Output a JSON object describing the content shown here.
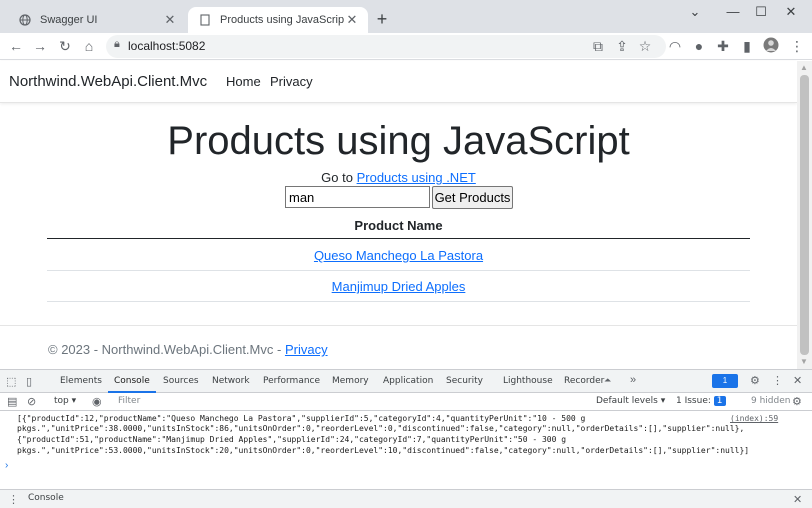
{
  "browser": {
    "tabs": [
      {
        "title": "Swagger UI",
        "favicon": "globe-icon"
      },
      {
        "title": "Products using JavaScript - Northwind",
        "favicon": "page-icon"
      }
    ],
    "url": "localhost:5082"
  },
  "site": {
    "brand": "Northwind.WebApi.Client.Mvc",
    "nav": [
      "Home",
      "Privacy"
    ]
  },
  "main": {
    "title": "Products using JavaScript",
    "goto_prefix": "Go to",
    "goto_link": "Products using .NET",
    "search_value": "man",
    "button_label": "Get Products",
    "column_header": "Product Name",
    "products": [
      "Queso Manchego La Pastora",
      "Manjimup Dried Apples"
    ]
  },
  "footer": {
    "text": "© 2023 - Northwind.WebApi.Client.Mvc -",
    "link": "Privacy"
  },
  "devtools": {
    "tabs": [
      "Elements",
      "Console",
      "Sources",
      "Network",
      "Performance",
      "Memory",
      "Application",
      "Security",
      "Lighthouse",
      "Recorder"
    ],
    "issues_badge": "1",
    "context": "top",
    "filter_placeholder": "Filter",
    "default_levels": "Default levels",
    "issue_label": "1 Issue:",
    "issue_count": "1",
    "hidden_label": "9 hidden",
    "console_lines": [
      "[{\"productId\":12,\"productName\":\"Queso Manchego La Pastora\",\"supplierId\":5,\"categoryId\":4,\"quantityPerUnit\":\"10 - 500 g",
      "pkgs.\",\"unitPrice\":38.0000,\"unitsInStock\":86,\"unitsOnOrder\":0,\"reorderLevel\":0,\"discontinued\":false,\"category\":null,\"orderDetails\":[],\"supplier\":null},",
      "{\"productId\":51,\"productName\":\"Manjimup Dried Apples\",\"supplierId\":24,\"categoryId\":7,\"quantityPerUnit\":\"50 - 300 g",
      "pkgs.\",\"unitPrice\":53.0000,\"unitsInStock\":20,\"unitsOnOrder\":0,\"reorderLevel\":10,\"discontinued\":false,\"category\":null,\"orderDetails\":[],\"supplier\":null}]"
    ],
    "console_source": "(index):59",
    "drawer_label": "Console"
  }
}
